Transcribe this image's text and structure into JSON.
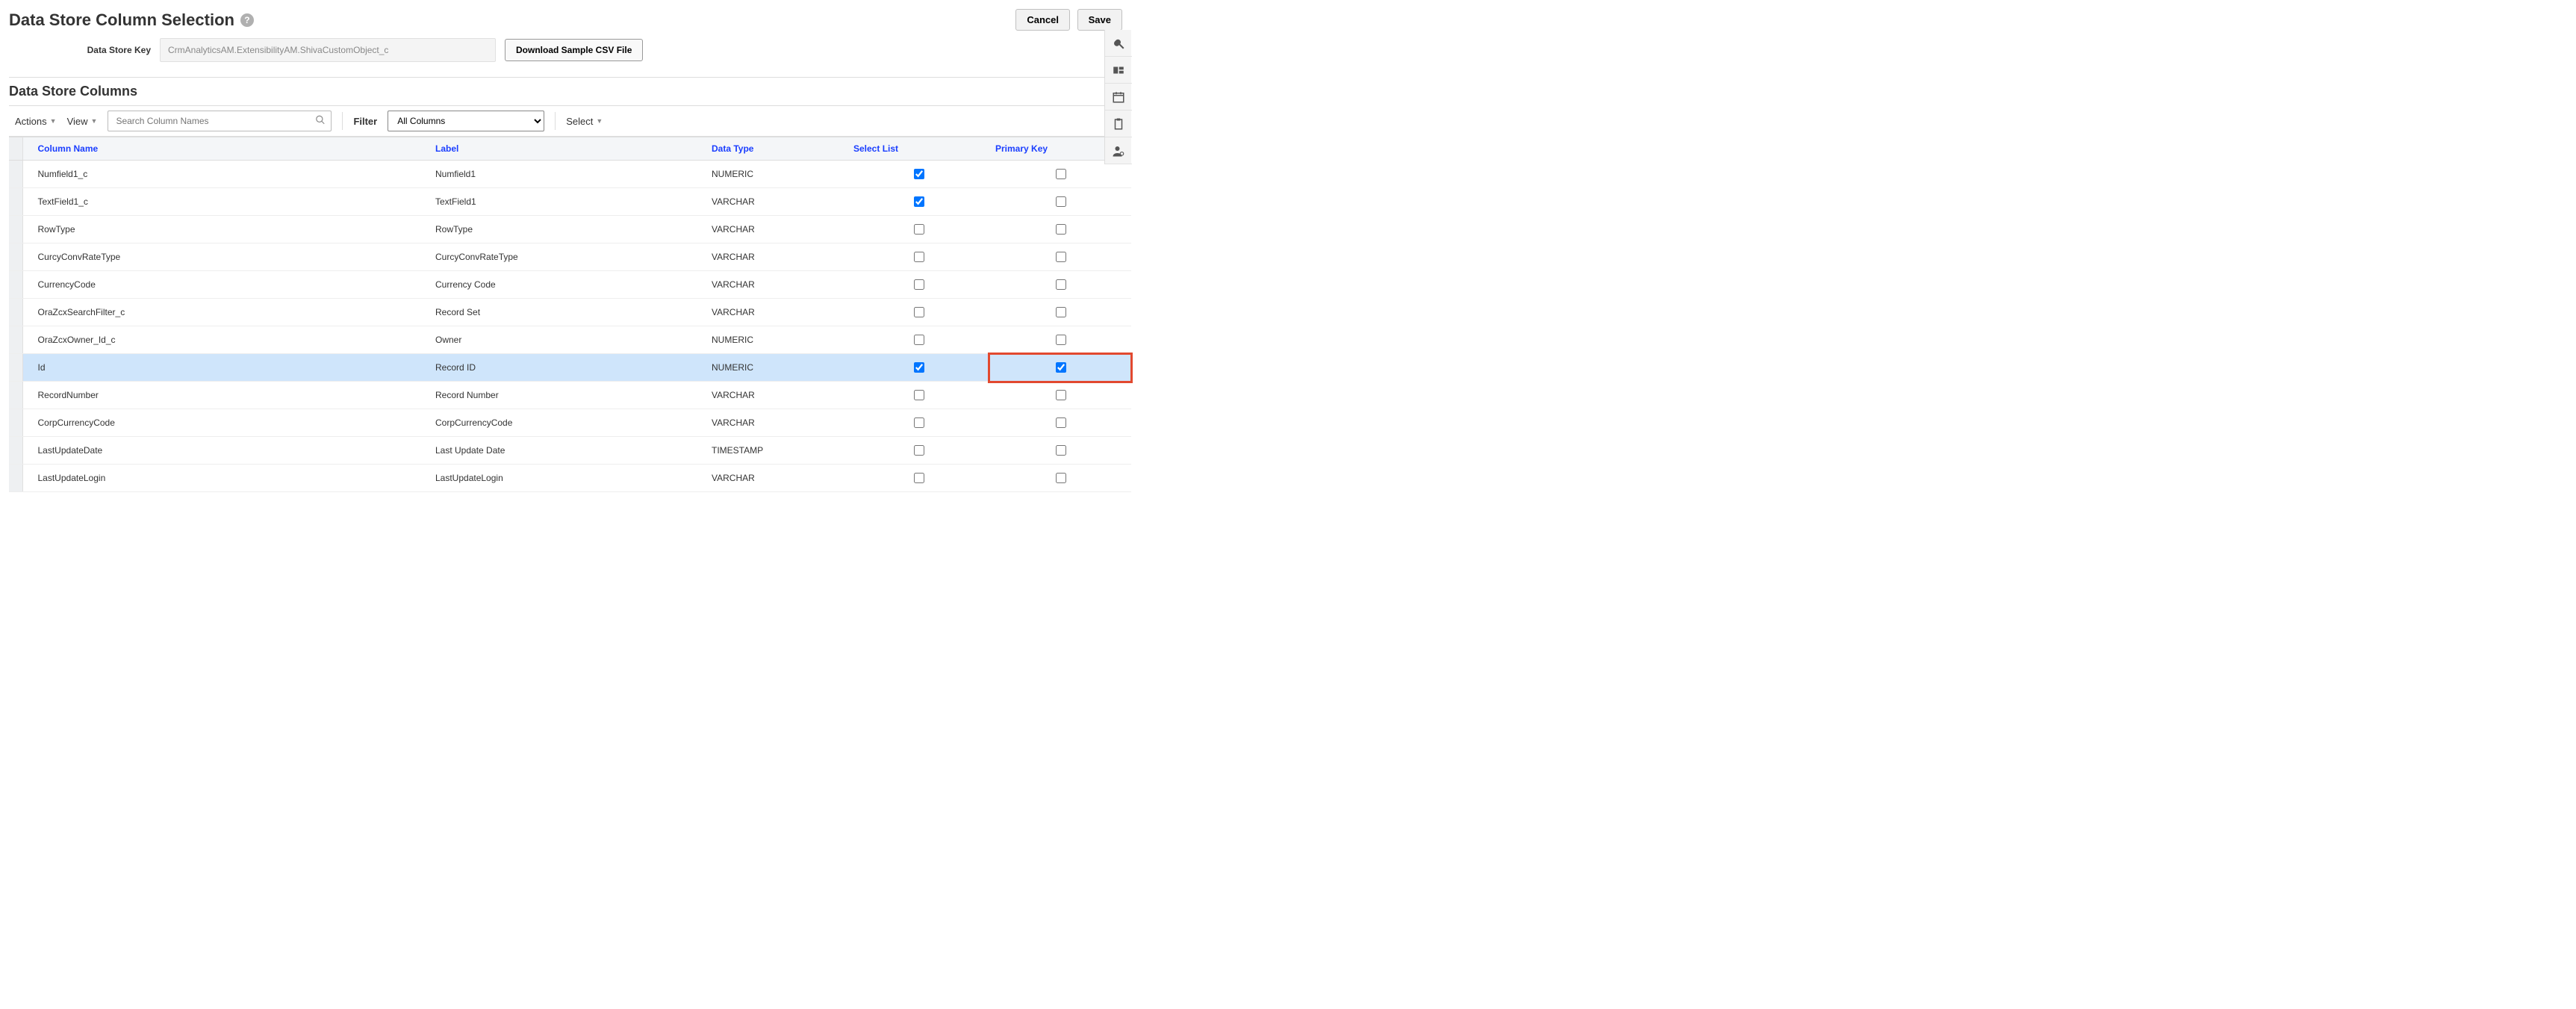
{
  "header": {
    "title": "Data Store Column Selection",
    "cancel": "Cancel",
    "save": "Save"
  },
  "form": {
    "key_label": "Data Store Key",
    "key_value": "CrmAnalyticsAM.ExtensibilityAM.ShivaCustomObject_c",
    "download": "Download Sample CSV File"
  },
  "section": {
    "title": "Data Store Columns"
  },
  "toolbar": {
    "actions": "Actions",
    "view": "View",
    "search_placeholder": "Search Column Names",
    "filter_label": "Filter",
    "filter_value": "All Columns",
    "select": "Select"
  },
  "columns": {
    "name": "Column Name",
    "label": "Label",
    "type": "Data Type",
    "select_list": "Select List",
    "pk": "Primary Key"
  },
  "rows": [
    {
      "name": "Numfield1_c",
      "label": "Numfield1",
      "type": "NUMERIC",
      "select": true,
      "pk": false,
      "selected": false
    },
    {
      "name": "TextField1_c",
      "label": "TextField1",
      "type": "VARCHAR",
      "select": true,
      "pk": false,
      "selected": false
    },
    {
      "name": "RowType",
      "label": "RowType",
      "type": "VARCHAR",
      "select": false,
      "pk": false,
      "selected": false
    },
    {
      "name": "CurcyConvRateType",
      "label": "CurcyConvRateType",
      "type": "VARCHAR",
      "select": false,
      "pk": false,
      "selected": false
    },
    {
      "name": "CurrencyCode",
      "label": "Currency Code",
      "type": "VARCHAR",
      "select": false,
      "pk": false,
      "selected": false
    },
    {
      "name": "OraZcxSearchFilter_c",
      "label": "Record Set",
      "type": "VARCHAR",
      "select": false,
      "pk": false,
      "selected": false
    },
    {
      "name": "OraZcxOwner_Id_c",
      "label": "Owner",
      "type": "NUMERIC",
      "select": false,
      "pk": false,
      "selected": false
    },
    {
      "name": "Id",
      "label": "Record ID",
      "type": "NUMERIC",
      "select": true,
      "pk": true,
      "selected": true
    },
    {
      "name": "RecordNumber",
      "label": "Record Number",
      "type": "VARCHAR",
      "select": false,
      "pk": false,
      "selected": false
    },
    {
      "name": "CorpCurrencyCode",
      "label": "CorpCurrencyCode",
      "type": "VARCHAR",
      "select": false,
      "pk": false,
      "selected": false
    },
    {
      "name": "LastUpdateDate",
      "label": "Last Update Date",
      "type": "TIMESTAMP",
      "select": false,
      "pk": false,
      "selected": false
    },
    {
      "name": "LastUpdateLogin",
      "label": "LastUpdateLogin",
      "type": "VARCHAR",
      "select": false,
      "pk": false,
      "selected": false
    }
  ],
  "rail": {
    "tools": "tools-icon",
    "layout": "layout-icon",
    "calendar": "calendar-icon",
    "clipboard": "clipboard-icon",
    "user": "user-settings-icon"
  }
}
